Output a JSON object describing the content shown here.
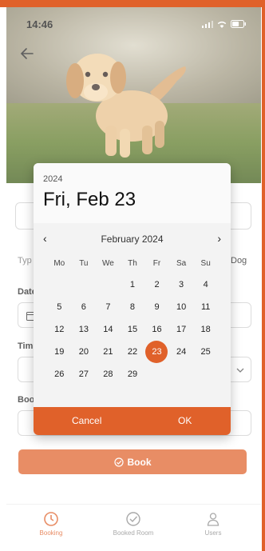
{
  "status_bar": {
    "time": "14:46"
  },
  "form": {
    "type_label_partial": "Typ",
    "type_value_partial": "Dog",
    "date_label_partial": "Date",
    "time_label_partial": "Tim",
    "book_label_partial": "Boo",
    "book_button": "Book"
  },
  "picker": {
    "year": "2024",
    "selected_date": "Fri, Feb 23",
    "month_label": "February 2024",
    "weekdays": [
      "Mo",
      "Tu",
      "We",
      "Th",
      "Fr",
      "Sa",
      "Su"
    ],
    "weeks": [
      [
        "",
        "",
        "",
        "1",
        "2",
        "3",
        "4"
      ],
      [
        "5",
        "6",
        "7",
        "8",
        "9",
        "10",
        "11"
      ],
      [
        "12",
        "13",
        "14",
        "15",
        "16",
        "17",
        "18"
      ],
      [
        "19",
        "20",
        "21",
        "22",
        "23",
        "24",
        "25"
      ],
      [
        "26",
        "27",
        "28",
        "29",
        "",
        "",
        ""
      ]
    ],
    "selected_day": "23",
    "cancel_label": "Cancel",
    "ok_label": "OK"
  },
  "nav": {
    "items": [
      {
        "label": "Booking",
        "icon": "clock-icon",
        "active": true
      },
      {
        "label": "Booked Room",
        "icon": "check-circle-icon",
        "active": false
      },
      {
        "label": "Users",
        "icon": "user-icon",
        "active": false
      }
    ]
  },
  "colors": {
    "accent": "#e0612a",
    "dialog_bg": "#f3f3f3"
  }
}
